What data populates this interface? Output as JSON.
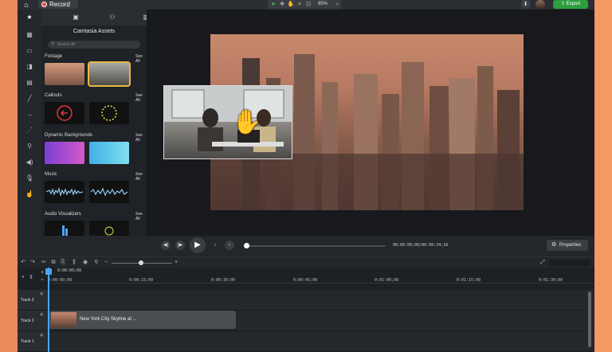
{
  "topbar": {
    "record_label": "Record",
    "zoom_value": "85%",
    "export_label": "Export"
  },
  "assets_panel": {
    "title": "Camtasia Assets",
    "search_placeholder": "Search All",
    "sections": [
      {
        "title": "Footage",
        "see_all": "See All"
      },
      {
        "title": "Callouts",
        "see_all": "See All"
      },
      {
        "title": "Dynamic Backgrounds",
        "see_all": "See All"
      },
      {
        "title": "Music",
        "see_all": "See All"
      },
      {
        "title": "Audio Visualizers",
        "see_all": "See All"
      }
    ]
  },
  "playback": {
    "timecode": "00:00:00;00/00:00:34;16",
    "properties_label": "Properties"
  },
  "timeline": {
    "playhead_time": "0:00:00;00",
    "ruler": [
      "0:00:00;00",
      "0:00:15;00",
      "0:00:30;00",
      "0:00:45;00",
      "0:01:00;00",
      "0:01:15;00",
      "0:01:30;00"
    ],
    "tracks": [
      "Track 3",
      "Track 2",
      "Track 1"
    ],
    "clip_label": "New York City Skyline at ..."
  },
  "icons": {
    "rail": [
      "star-icon",
      "media-icon",
      "annotations-icon",
      "transitions-icon",
      "behaviors-icon",
      "animations-icon",
      "cursor-effects-icon",
      "voice-narration-icon",
      "audio-effects-icon",
      "visual-effects-icon",
      "interactivity-icon",
      "gesture-icon"
    ]
  },
  "colors": {
    "export": "#2e9e3f",
    "selection": "#e8b845",
    "playhead": "#4aa3ff"
  }
}
